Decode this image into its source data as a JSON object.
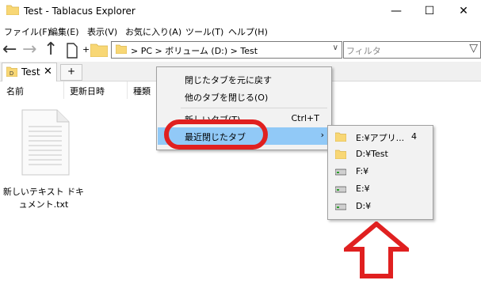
{
  "window": {
    "title": "Test - Tablacus Explorer",
    "controls": {
      "minimize": "—",
      "maximize": "☐",
      "close": "✕"
    }
  },
  "menubar": {
    "items": [
      {
        "label": "ファイル(F)"
      },
      {
        "label": "編集(E)"
      },
      {
        "label": "表示(V)"
      },
      {
        "label": "お気に入り(A)"
      },
      {
        "label": "ツール(T)"
      },
      {
        "label": "ヘルプ(H)"
      }
    ]
  },
  "toolbar": {
    "back_glyph": "←",
    "forward_glyph": "→",
    "up_glyph": "↑",
    "plus_glyph": "+"
  },
  "address": {
    "path": "> PC > ボリューム (D:) > Test",
    "dropdown_glyph": "∨"
  },
  "filter": {
    "placeholder": "フィルタ",
    "icon_glyph": "▽"
  },
  "tabs": [
    {
      "label": "Test",
      "close_glyph": "✕"
    }
  ],
  "newtab_glyph": "+",
  "columns": [
    {
      "label": "名前"
    },
    {
      "label": "更新日時"
    },
    {
      "label": "種類"
    }
  ],
  "files": [
    {
      "name": "新しいテキスト ドキュメント.txt",
      "icon": "text-file-icon"
    }
  ],
  "context_menu": {
    "items": [
      {
        "label": "閉じたタブを元に戻す",
        "shortcut": ""
      },
      {
        "label": "他のタブを閉じる(O)",
        "shortcut": ""
      },
      {
        "label": "新しいタブ(T)",
        "shortcut": "Ctrl+T"
      },
      {
        "label": "最近閉じたタブ",
        "shortcut": "",
        "submenu_arrow": "›",
        "highlighted": true
      }
    ]
  },
  "submenu": {
    "items": [
      {
        "label": "E:¥アプリ...",
        "count": "4",
        "icon": "folder-icon"
      },
      {
        "label": "D:¥Test",
        "count": "",
        "icon": "folder-icon"
      },
      {
        "label": "F:¥",
        "count": "",
        "icon": "drive-icon"
      },
      {
        "label": "E:¥",
        "count": "",
        "icon": "drive-icon"
      },
      {
        "label": "D:¥",
        "count": "",
        "icon": "drive-icon"
      }
    ]
  },
  "colors": {
    "highlight": "#91c9f7",
    "annotation_red": "#e02020",
    "folder_yellow": "#f8d775"
  }
}
